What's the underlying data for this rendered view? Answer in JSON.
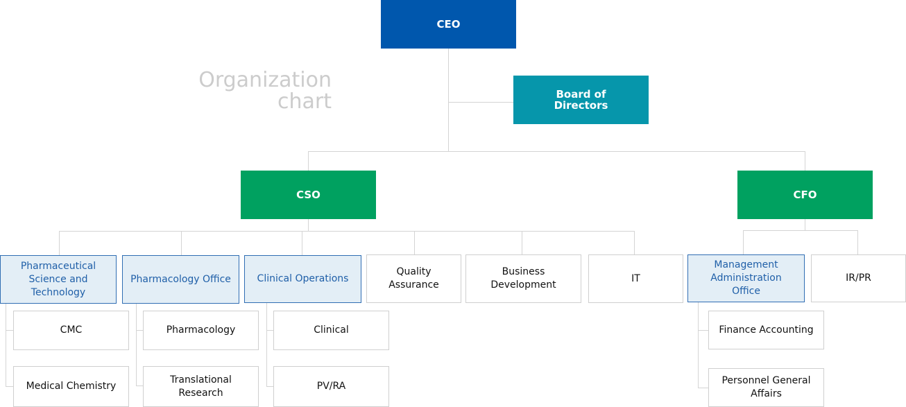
{
  "title": {
    "line1": "Organization",
    "line2": "chart"
  },
  "colors": {
    "ceo": "#0057ad",
    "board": "#0696ab",
    "executive": "#00a160",
    "office_fill": "#e3eef6",
    "office_text": "#1f5fa8",
    "connector": "#d4d4d4"
  },
  "nodes": {
    "ceo": "CEO",
    "board": "Board of Directors",
    "cso": "CSO",
    "cfo": "CFO",
    "pharm_sci": "Pharmaceutical Science and Technology",
    "pharmacology_office": "Pharmacology Office",
    "clinical_operations": "Clinical Operations",
    "quality_assurance": "Quality Assurance",
    "business_development": "Business Development",
    "it": "IT",
    "management_admin": "Management Administration Office",
    "ir_pr": "IR/PR",
    "cmc": "CMC",
    "medical_chemistry": "Medical Chemistry",
    "pharmacology": "Pharmacology",
    "translational_research": "Translational Research",
    "clinical": "Clinical",
    "pv_ra": "PV/RA",
    "finance_accounting": "Finance Accounting",
    "personnel_general_affairs": "Personnel General Affairs"
  }
}
